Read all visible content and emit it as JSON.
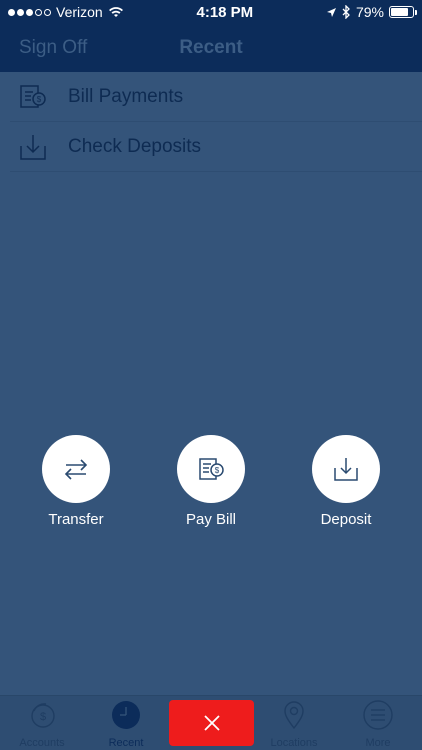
{
  "status": {
    "carrier": "Verizon",
    "time": "4:18 PM",
    "battery": "79%",
    "battery_level": 0.79
  },
  "nav": {
    "left": "Sign Off",
    "title": "Recent"
  },
  "list": [
    {
      "label": "Bill Payments",
      "icon": "bill-payment-icon"
    },
    {
      "label": "Check Deposits",
      "icon": "deposit-tray-icon"
    }
  ],
  "actions": [
    {
      "label": "Transfer",
      "icon": "transfer-arrows-icon"
    },
    {
      "label": "Pay Bill",
      "icon": "pay-bill-icon"
    },
    {
      "label": "Deposit",
      "icon": "deposit-icon"
    }
  ],
  "tabs": [
    {
      "label": "Accounts",
      "icon": "dollar-coin-icon"
    },
    {
      "label": "Recent",
      "icon": "clock-icon"
    },
    {
      "label": "",
      "icon": "close-icon"
    },
    {
      "label": "Locations",
      "icon": "location-pin-icon"
    },
    {
      "label": "More",
      "icon": "menu-icon"
    }
  ],
  "colors": {
    "background": "#34547a",
    "header": "#0c2c5a",
    "close_button": "#ee1c1c",
    "action_circle": "#ffffff"
  }
}
